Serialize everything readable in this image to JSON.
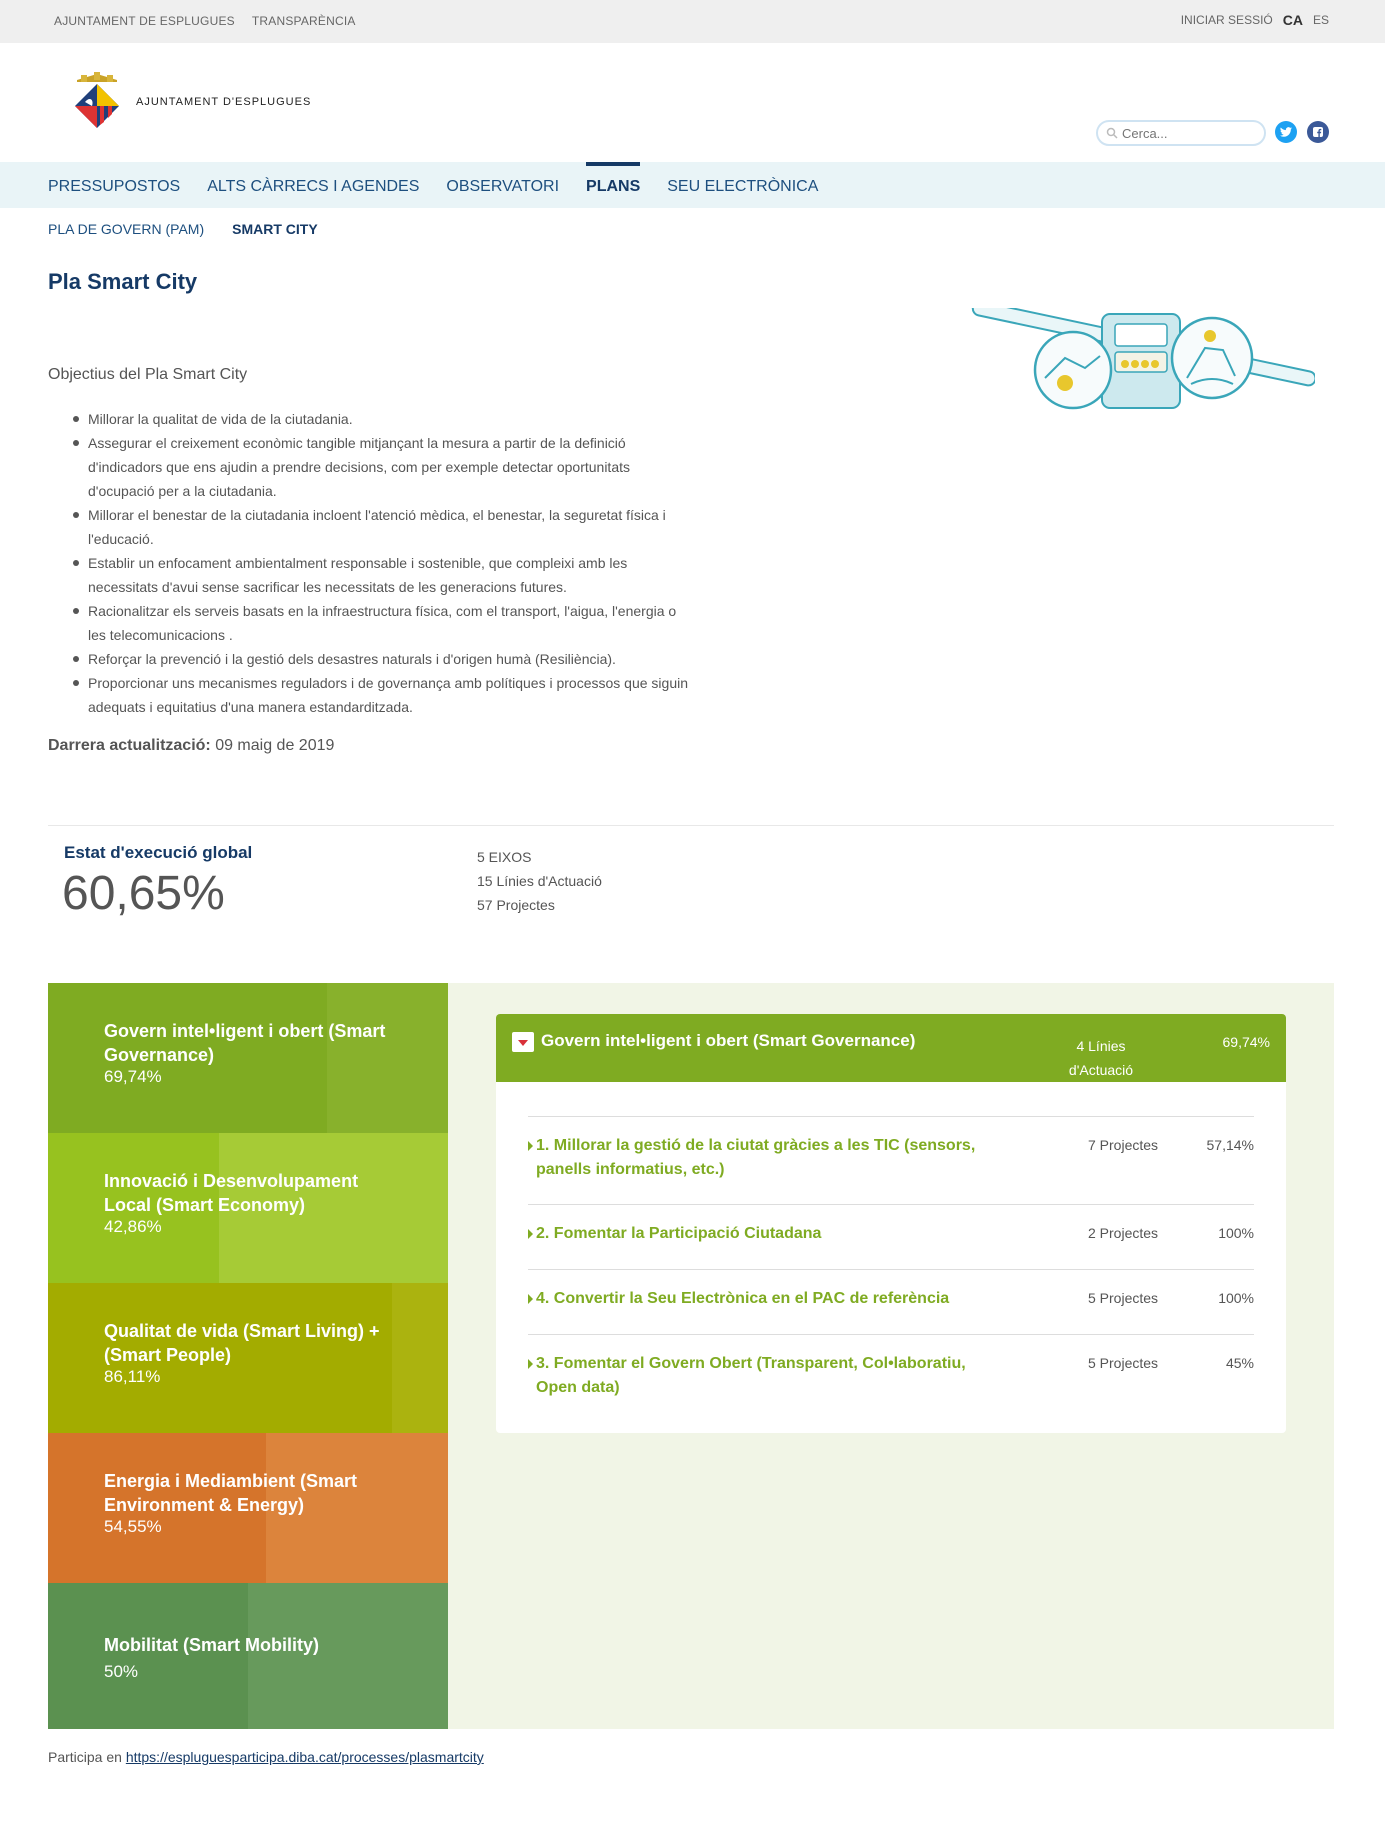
{
  "topbar": {
    "left_links": [
      "AJUNTAMENT DE ESPLUGUES",
      "TRANSPARÈNCIA"
    ],
    "login": "INICIAR SESSIÓ",
    "lang_active": "CA",
    "lang_other": "ES"
  },
  "header": {
    "org_name": "AJUNTAMENT D'ESPLUGUES",
    "search_placeholder": "Cerca..."
  },
  "main_nav": [
    "PRESSUPOSTOS",
    "ALTS CÀRRECS I AGENDES",
    "OBSERVATORI",
    "PLANS",
    "SEU ELECTRÒNICA"
  ],
  "main_nav_active": "PLANS",
  "sub_nav": [
    "PLA DE GOVERN (PAM)",
    "SMART CITY"
  ],
  "sub_nav_active": "SMART CITY",
  "page_title": "Pla Smart City",
  "objectives_title": "Objectius del Pla Smart City",
  "objectives": [
    "Millorar la qualitat de vida de la ciutadania.",
    "Assegurar el creixement econòmic tangible mitjançant la mesura a partir de la definició d'indicadors que ens ajudin a prendre decisions, com per exemple detectar oportunitats d'ocupació per a la ciutadania.",
    "Millorar el benestar de la ciutadania incloent l'atenció mèdica, el benestar, la seguretat física i l'educació.",
    "Establir un enfocament ambientalment responsable i sostenible, que compleixi amb les necessitats d'avui sense sacrificar les necessitats de les generacions futures.",
    "Racionalitzar els serveis basats en la infraestructura física, com el transport, l'aigua, l'energia o les telecomunicacions .",
    "Reforçar la prevenció i la gestió dels desastres naturals i d'origen humà (Resiliència).",
    "Proporcionar uns mecanismes reguladors i de governança amb polítiques i processos que siguin adequats i equitatius d'una manera estandarditzada."
  ],
  "updated_label": "Darrera actualització:",
  "updated_value": "09 maig de 2019",
  "global": {
    "label": "Estat d'execució global",
    "value": "60,65%",
    "stats": [
      "5 EIXOS",
      "15 Línies d'Actuació",
      "57 Projectes"
    ]
  },
  "axes": [
    {
      "title": "Govern intel•ligent i obert (Smart Governance)",
      "pct": "69,74%",
      "progress": 0.6974,
      "color": "#7fab22",
      "shade": "#88b12c"
    },
    {
      "title": "Innovació i Desenvolupament Local (Smart Economy)",
      "pct": "42,86%",
      "progress": 0.4286,
      "color": "#97c21f",
      "shade": "#a6cb36"
    },
    {
      "title": "Qualitat de vida (Smart Living) + (Smart People)",
      "pct": "86,11%",
      "progress": 0.8611,
      "color": "#a3ac00",
      "shade": "#abb30f"
    },
    {
      "title": "Energia i Mediambient (Smart Environment & Energy)",
      "pct": "54,55%",
      "progress": 0.5455,
      "color": "#d5742b",
      "shade": "#dc843c"
    },
    {
      "title": "Mobilitat (Smart Mobility)",
      "pct": "50%",
      "progress": 0.5,
      "color": "#5b9150",
      "shade": "#679a5c"
    }
  ],
  "card": {
    "title": "Govern intel•ligent i obert (Smart Governance)",
    "lines": "4 Línies d'Actuació",
    "pct": "69,74%",
    "rows": [
      {
        "name": "1. Millorar la gestió de la ciutat gràcies a les TIC (sensors, panells informatius, etc.)",
        "projects": "7 Projectes",
        "pct": "57,14%"
      },
      {
        "name": "2. Fomentar la Participació Ciutadana",
        "projects": "2 Projectes",
        "pct": "100%"
      },
      {
        "name": "4. Convertir la Seu Electrònica en el PAC de referència",
        "projects": "5 Projectes",
        "pct": "100%"
      },
      {
        "name": "3. Fomentar el Govern Obert (Transparent, Col•laboratiu, Open data)",
        "projects": "5 Projectes",
        "pct": "45%"
      }
    ]
  },
  "participa": {
    "text": "Participa en",
    "link": "https://espluguesparticipa.diba.cat/processes/plasmartcity"
  }
}
